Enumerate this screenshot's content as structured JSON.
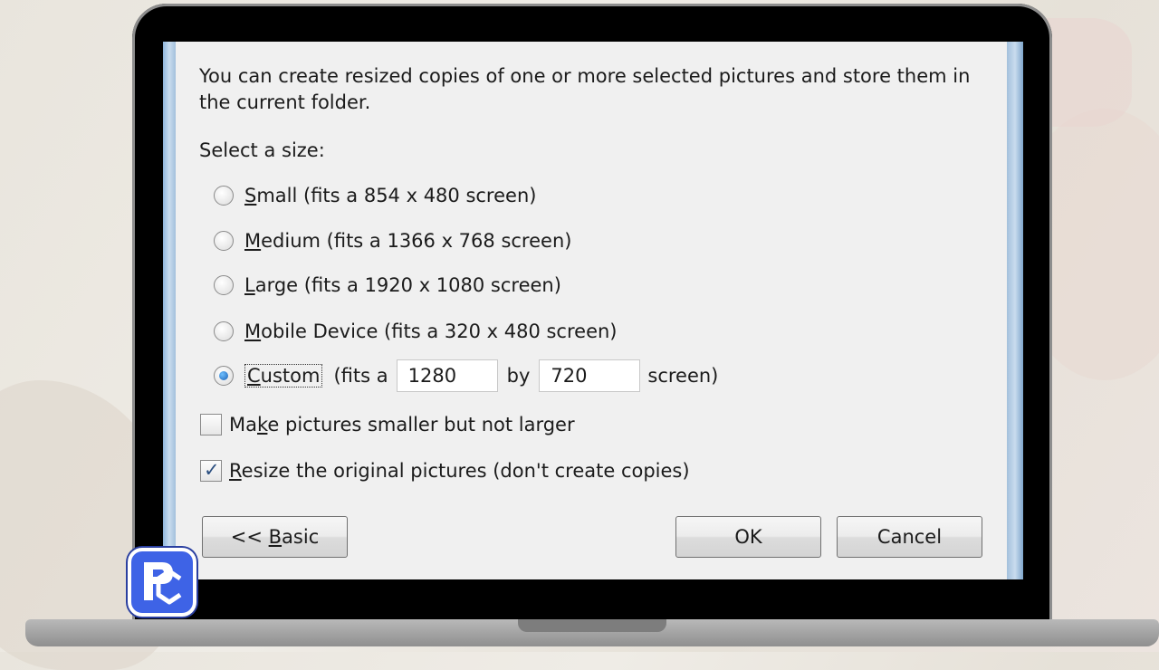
{
  "dialog": {
    "intro_text": "You can create resized copies of one or more selected pictures and store them in the current folder.",
    "select_label": "Select a size:",
    "options": [
      {
        "prefix": "",
        "mnemonic": "S",
        "rest": "mall (fits a 854 x 480 screen)",
        "checked": false
      },
      {
        "prefix": "",
        "mnemonic": "M",
        "rest": "edium (fits a 1366 x 768 screen)",
        "checked": false
      },
      {
        "prefix": "",
        "mnemonic": "L",
        "rest": "arge (fits a 1920 x 1080 screen)",
        "checked": false
      },
      {
        "prefix": "",
        "mnemonic": "M",
        "rest": "obile Device (fits a 320 x 480 screen)",
        "checked": false
      }
    ],
    "custom": {
      "mnemonic": "C",
      "rest": "ustom",
      "fits_label": "(fits a",
      "width": "1280",
      "by_label": "by",
      "height": "720",
      "screen_label": "screen)",
      "checked": true
    },
    "checkbox_smaller": {
      "prefix": "Ma",
      "mnemonic": "k",
      "rest": "e pictures smaller but not larger",
      "checked": false
    },
    "checkbox_resize": {
      "prefix": "",
      "mnemonic": "R",
      "rest": "esize the original pictures (don't create copies)",
      "checked": true
    },
    "buttons": {
      "basic": {
        "prefix": "<< ",
        "mnemonic": "B",
        "rest": "asic"
      },
      "ok": "OK",
      "cancel": "Cancel"
    }
  },
  "colors": {
    "dialog_bg": "#f0f0f0",
    "window_frame": "#a3c0dc",
    "logo_bg": "#3e63e6"
  },
  "logo": {
    "icon": "pc-logo-icon"
  }
}
